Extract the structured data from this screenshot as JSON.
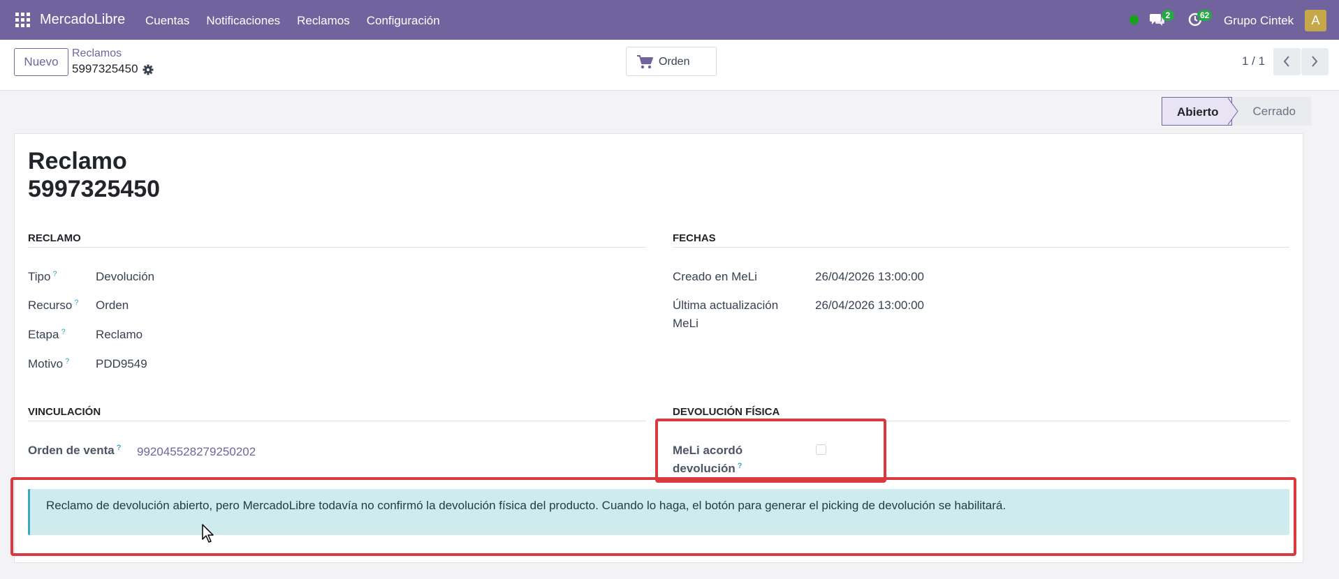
{
  "navbar": {
    "brand": "MercadoLibre",
    "menu": [
      "Cuentas",
      "Notificaciones",
      "Reclamos",
      "Configuración"
    ],
    "chat_count": "2",
    "activity_count": "62",
    "company": "Grupo Cintek",
    "avatar_letter": "A",
    "presence_color": "#17a217",
    "accent": "#71639e"
  },
  "control": {
    "new_label": "Nuevo",
    "breadcrumb": "Reclamos",
    "record_id": "5997325450",
    "smart_button": "Orden",
    "pager": "1 / 1"
  },
  "status": {
    "stages": [
      "Abierto",
      "Cerrado"
    ],
    "active": "Abierto"
  },
  "record": {
    "title_label": "Reclamo",
    "title_number": "5997325450"
  },
  "groups": {
    "reclamo": {
      "title": "Reclamo",
      "fields": [
        {
          "label": "Tipo",
          "help": "?",
          "value": "Devolución"
        },
        {
          "label": "Recurso",
          "help": "?",
          "value": "Orden"
        },
        {
          "label": "Etapa",
          "help": "?",
          "value": "Reclamo"
        },
        {
          "label": "Motivo",
          "help": "?",
          "value": "PDD9549"
        }
      ]
    },
    "fechas": {
      "title": "Fechas",
      "fields": [
        {
          "label": "Creado en MeLi",
          "value": "26/04/2026 13:00:00"
        },
        {
          "label_line1": "Última actualización",
          "label_line2": "MeLi",
          "value": "26/04/2026 13:00:00"
        }
      ]
    },
    "vinculacion": {
      "title": "Vinculación",
      "order_label": "Orden de venta",
      "help": "?",
      "order_value": "992045528279250202"
    },
    "devolucion": {
      "title": "Devolución física",
      "label_line1": "MeLi acordó",
      "label_line2": "devolución",
      "help": "?",
      "checked": false
    }
  },
  "alert": {
    "text": "Reclamo de devolución abierto, pero MercadoLibre todavía no confirmó la devolución física del producto. Cuando lo haga, el botón para generar el picking de devolución se habilitará."
  },
  "highlight_color": "#d93a3e"
}
